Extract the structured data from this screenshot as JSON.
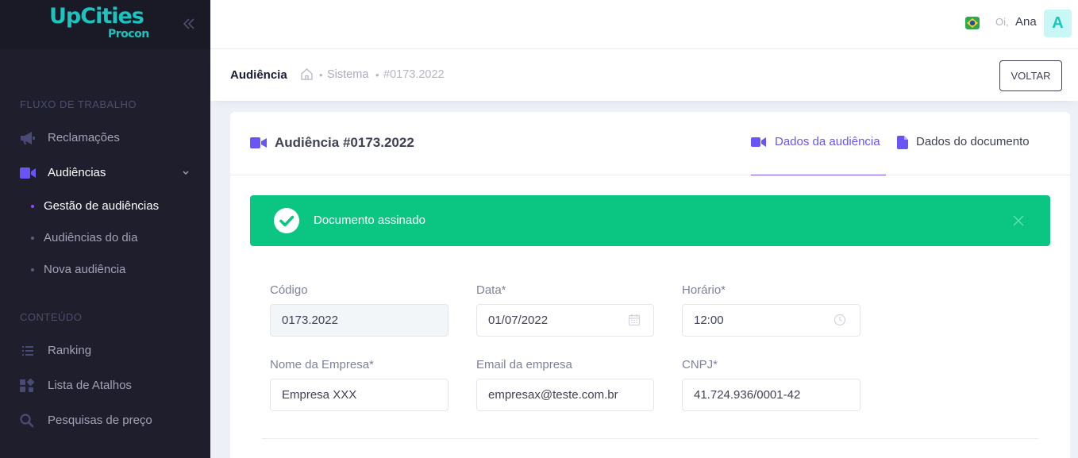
{
  "brand": {
    "name": "UpCities",
    "sub": "Procon"
  },
  "sidebar": {
    "sections": [
      {
        "title": "FLUXO DE TRABALHO"
      },
      {
        "title": "CONTEÚDO"
      }
    ],
    "items": [
      {
        "label": "Reclamações",
        "icon": "megaphone-icon"
      },
      {
        "label": "Audiências",
        "icon": "video-camera-icon",
        "expanded": true
      },
      {
        "label": "Ranking",
        "icon": "list-icon"
      },
      {
        "label": "Lista de Atalhos",
        "icon": "shortcuts-icon"
      },
      {
        "label": "Pesquisas de preço",
        "icon": "search-icon"
      }
    ],
    "sub_items": [
      {
        "label": "Gestão de audiências",
        "active": true
      },
      {
        "label": "Audiências do dia"
      },
      {
        "label": "Nova audiência"
      }
    ]
  },
  "header": {
    "greeting": "Oi,",
    "user_name": "Ana",
    "avatar_letter": "A"
  },
  "subheader": {
    "title": "Audiência",
    "breadcrumb": [
      "Sistema",
      "#0173.2022"
    ],
    "back_label": "VOLTAR"
  },
  "card": {
    "title": "Audiência #0173.2022",
    "tabs": [
      {
        "label": "Dados da audiência",
        "active": true
      },
      {
        "label": "Dados do documento"
      }
    ],
    "alert": {
      "text": "Documento assinado"
    },
    "fields": {
      "codigo": {
        "label": "Código",
        "value": "0173.2022"
      },
      "data": {
        "label": "Data*",
        "value": "01/07/2022"
      },
      "horario": {
        "label": "Horário*",
        "value": "12:00"
      },
      "empresa": {
        "label": "Nome da Empresa*",
        "value": "Empresa XXX"
      },
      "email": {
        "label": "Email da empresa",
        "value": "empresax@teste.com.br"
      },
      "cnpj": {
        "label": "CNPJ*",
        "value": "41.724.936/0001-42"
      }
    }
  },
  "colors": {
    "sidebar_bg": "#1e1e2d",
    "accent": "#6955f5",
    "success": "#0bc583",
    "brand_teal": "#1bc5bd"
  }
}
